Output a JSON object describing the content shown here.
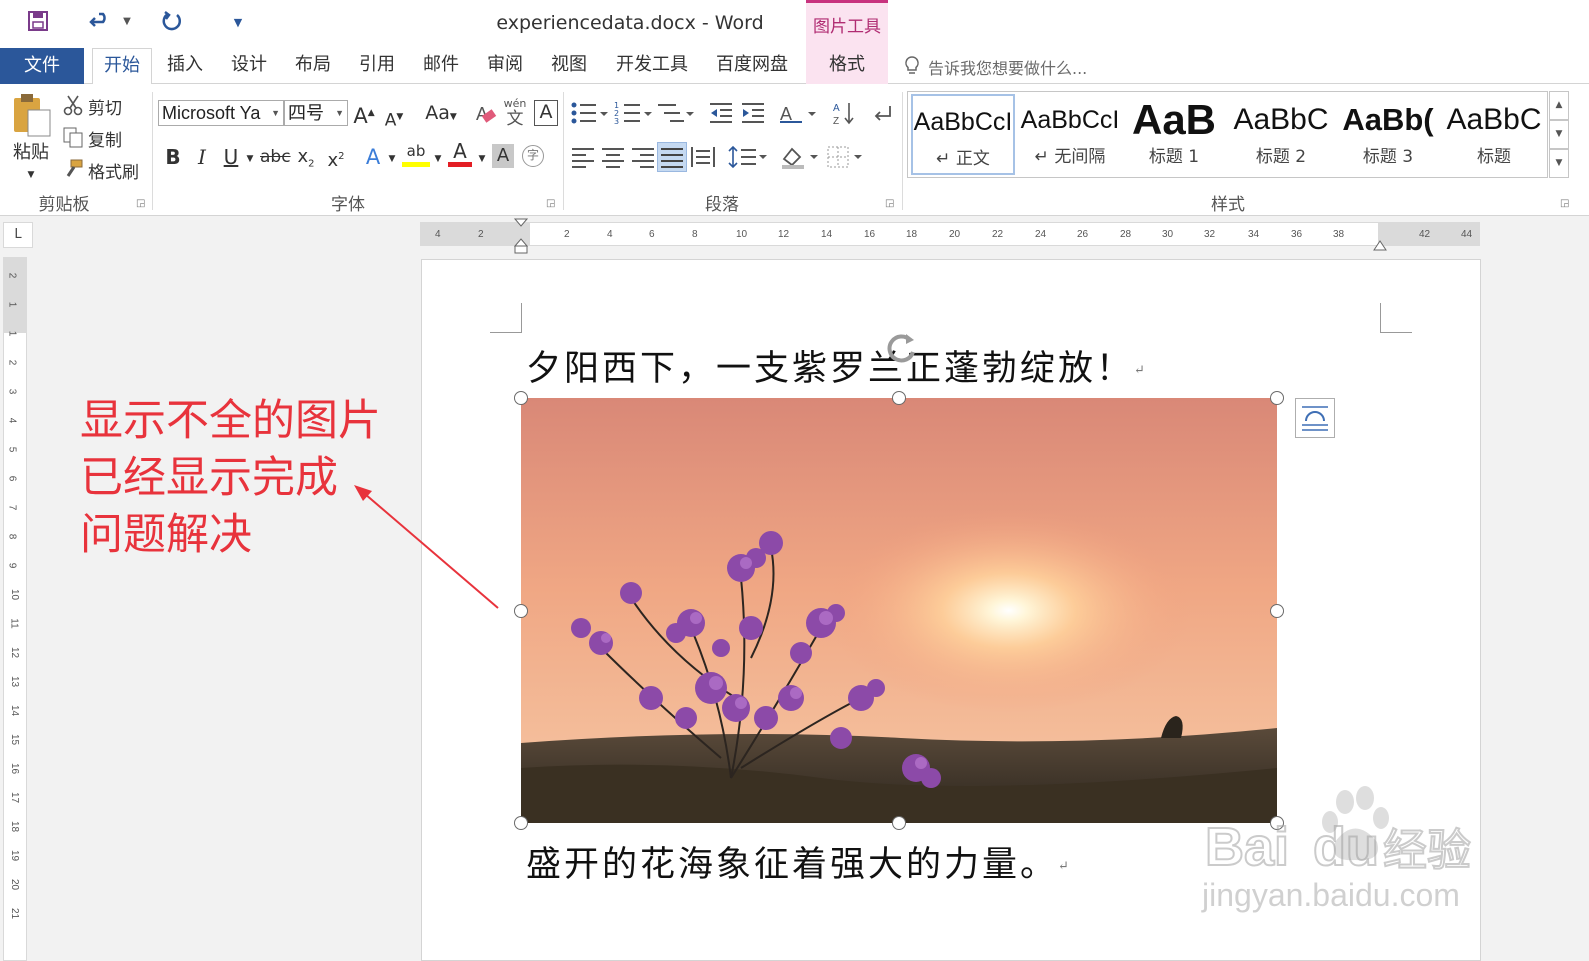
{
  "window": {
    "title": "experiencedata.docx - Word",
    "context_tab_title": "图片工具"
  },
  "qat": {
    "save_icon": "save-icon",
    "undo_icon": "undo-icon",
    "redo_icon": "redo-icon",
    "customize_icon": "customize-qat-icon"
  },
  "tabs": {
    "file": "文件",
    "home": "开始",
    "insert": "插入",
    "design": "设计",
    "layout": "布局",
    "references": "引用",
    "mailings": "邮件",
    "review": "审阅",
    "view": "视图",
    "developer": "开发工具",
    "baidu": "百度网盘",
    "format": "格式"
  },
  "tell_me": "告诉我您想要做什么...",
  "clipboard": {
    "paste": "粘贴",
    "cut": "剪切",
    "copy": "复制",
    "format_painter": "格式刷",
    "group": "剪贴板"
  },
  "font": {
    "name": "Microsoft Ya",
    "size": "四号",
    "group": "字体",
    "grow": "A",
    "shrink": "A",
    "change_case": "Aa",
    "phonetic": "wén",
    "phonetic_char": "文",
    "bold": "B",
    "italic": "I",
    "underline": "U",
    "strikethrough": "abc",
    "subscript": "x",
    "superscript": "x",
    "font_color_letter": "A",
    "highlight_letter": "ab",
    "char_shading": "A",
    "enclose": "字"
  },
  "paragraph": {
    "group": "段落"
  },
  "styles": {
    "group": "样式",
    "items": [
      {
        "preview": "AaBbCcI",
        "name": "正文"
      },
      {
        "preview": "AaBbCcI",
        "name": "无间隔"
      },
      {
        "preview": "AaB",
        "name": "标题 1"
      },
      {
        "preview": "AaBbC",
        "name": "标题 2"
      },
      {
        "preview": "AaBb(",
        "name": "标题 3"
      },
      {
        "preview": "AaBbC",
        "name": "标题"
      }
    ]
  },
  "ruler": {
    "h_ticks": [
      "4",
      "2",
      "2",
      "4",
      "6",
      "8",
      "10",
      "12",
      "14",
      "16",
      "18",
      "20",
      "22",
      "24",
      "26",
      "28",
      "30",
      "32",
      "34",
      "36",
      "38",
      "42",
      "44"
    ],
    "v_ticks": [
      "2",
      "1",
      "1",
      "2",
      "3",
      "4",
      "5",
      "6",
      "7",
      "8",
      "9",
      "10",
      "11",
      "12",
      "13",
      "14",
      "15",
      "16",
      "17",
      "18",
      "19",
      "20",
      "21"
    ],
    "corner": "L"
  },
  "document": {
    "line1": "夕阳西下，一支紫罗兰正蓬勃绽放！",
    "line2": "盛开的花海象征着强大的力量。",
    "paragraph_mark": "↵",
    "image": {
      "subject": "sunset-with-purple-flowers",
      "alt": "夕阳与紫色花丛"
    }
  },
  "annotation": {
    "line1": "显示不全的图片",
    "line2": "已经显示完成",
    "line3": "问题解决",
    "color": "#e8333c"
  },
  "watermark": {
    "text": "jingyan.baidu.com",
    "logo_text": "Bai du 经验"
  },
  "colors": {
    "accent": "#2b579a",
    "context_tab": "#c8327e"
  }
}
